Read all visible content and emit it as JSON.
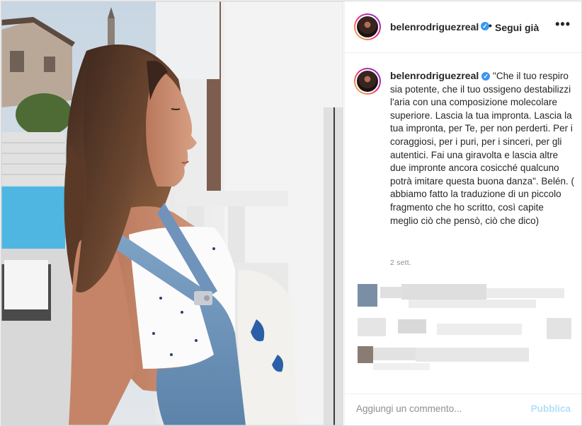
{
  "post": {
    "username": "belenrodriguezreal",
    "verified": true,
    "follow_separator": "•",
    "follow_label": "Segui già",
    "more_icon": "more-options-icon"
  },
  "caption": {
    "username": "belenrodriguezreal",
    "text": "\"Che il tuo respiro sia potente, che il tuo ossigeno destabilizzi l'aria con una composizione molecolare superiore. Lascia la tua impronta. Lascia la tua impronta, per Te, per non perderti. Per i coraggiosi, per i puri, per i sinceri, per gli autentici. Fai una giravolta e lascia altre due impronte ancora cosicché qualcuno potrà imitare questa buona danza\". Belén. ( abbiamo fatto la traduzione di un piccolo fragmento che ho scritto, così capite meglio ciò che pensò, ciò che dico)",
    "time": "2 sett."
  },
  "comment_box": {
    "placeholder": "Aggiungi un commento...",
    "post_label": "Pubblica"
  },
  "colors": {
    "verified": "#3897f0",
    "publish_disabled": "#b2dffc",
    "muted": "#8e8e8e"
  }
}
